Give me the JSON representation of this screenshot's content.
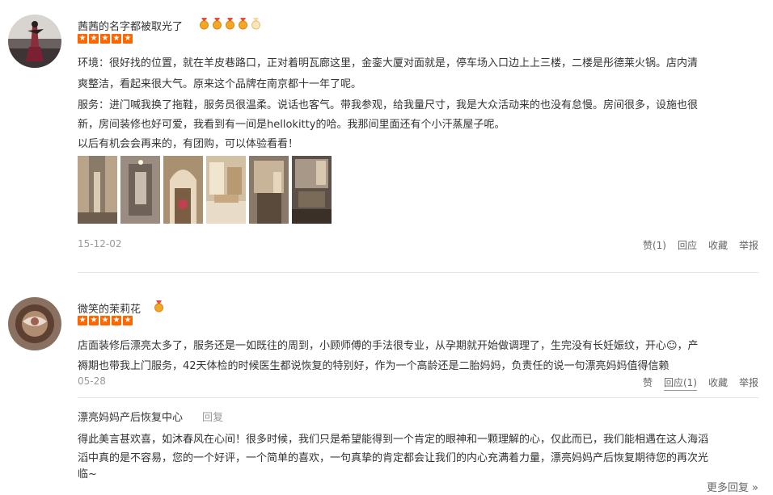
{
  "reviews": [
    {
      "user": "茜茜的名字都被取光了",
      "body": [
        "环境：很好找的位置，就在羊皮巷路口，正对着明瓦廊这里，金銮大厦对面就是，停车场入口边上上三楼，二楼是彤德莱火锅。店内清",
        "爽整洁，看起来很大气。原来这个品牌在南京都十一年了呢。",
        "服务：进门喊我换了拖鞋，服务员很温柔。说话也客气。带我参观，给我量尺寸，我是大众活动来的也没有怠慢。房间很多，设施也很",
        "新，房间装修也好可爱，我看到有一间是hellokitty的哈。我那间里面还有个小汗蒸屋子呢。",
        "以后有机会会再来的，有团购，可以体验看看！"
      ],
      "date": "15-12-02",
      "actions": [
        "赞(1)",
        "回应",
        "收藏",
        "举报"
      ]
    },
    {
      "user": "微笑的茉莉花",
      "body": [
        "店面装修后漂亮太多了，服务还是一如既往的周到，小顾师傅的手法很专业，从孕期就开始做调理了，生完没有长妊娠纹，开心☺，产",
        "褥期也带我上门服务，42天体检的时候医生都说恢复的特别好，作为一个高龄还是二胎妈妈，负责任的说一句漂亮妈妈值得信赖"
      ],
      "date": "05-28",
      "actions": [
        "赞",
        "回应(1)",
        "收藏",
        "举报"
      ]
    }
  ],
  "merchant_reply": {
    "name": "漂亮妈妈产后恢复中心",
    "reply_label": "回复",
    "body": [
      "得此美言甚欢喜，如沐春风在心间！很多时候，我们只是希望能得到一个肯定的眼神和一颗理解的心，仅此而已，我们能相遇在这人海滔",
      "滔中真的是不容易，您的一个好评，一个简单的喜欢，一句真挚的肯定都会让我们的内心充满着力量，漂亮妈妈产后恢复期待您的再次光",
      "临~"
    ]
  },
  "more_replies": "更多回复 »",
  "colors": {
    "star": "#ff6600",
    "medal": "#f5a623",
    "text": "#333333",
    "muted": "#999999"
  },
  "icons": {
    "medal": "medal-icon",
    "star": "star-icon"
  }
}
